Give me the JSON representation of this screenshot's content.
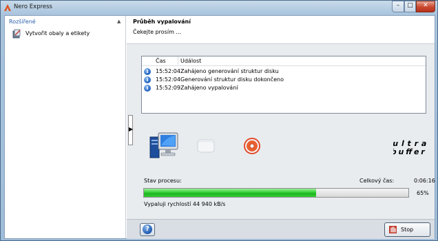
{
  "window": {
    "title": "Nero Express"
  },
  "sidebar": {
    "section_title": "Rozšířené",
    "items": [
      {
        "label": "Vytvořit obaly a etikety"
      }
    ]
  },
  "header": {
    "title": "Průběh vypalování",
    "subtitle": "Čekejte prosím ..."
  },
  "log": {
    "columns": {
      "time": "Čas",
      "event": "Událost"
    },
    "rows": [
      {
        "icon": "info-icon",
        "time": "15:52:04",
        "event": "Zahájeno generování struktur disku"
      },
      {
        "icon": "info-icon",
        "time": "15:52:04",
        "event": "Generování struktur disku dokončeno"
      },
      {
        "icon": "info-icon",
        "time": "15:52:09",
        "event": "Zahájeno vypalování"
      }
    ]
  },
  "process_icons": [
    "computer-icon",
    "disc-blank-icon",
    "burning-disc-icon",
    "ultrabuffer-logo"
  ],
  "progress": {
    "status_label": "Stav procesu:",
    "total_time_label": "Celkový čas:",
    "total_time_value": "0:06:16",
    "percent_text": "65%",
    "percent": 65,
    "speed_text": "Vypaluji rychlostí 44 940 kB/s"
  },
  "footer": {
    "stop_label": "Stop"
  },
  "colors": {
    "accent_blue": "#2b5fab",
    "progress_green": "#2ecc2e",
    "close_red": "#c9482f"
  }
}
